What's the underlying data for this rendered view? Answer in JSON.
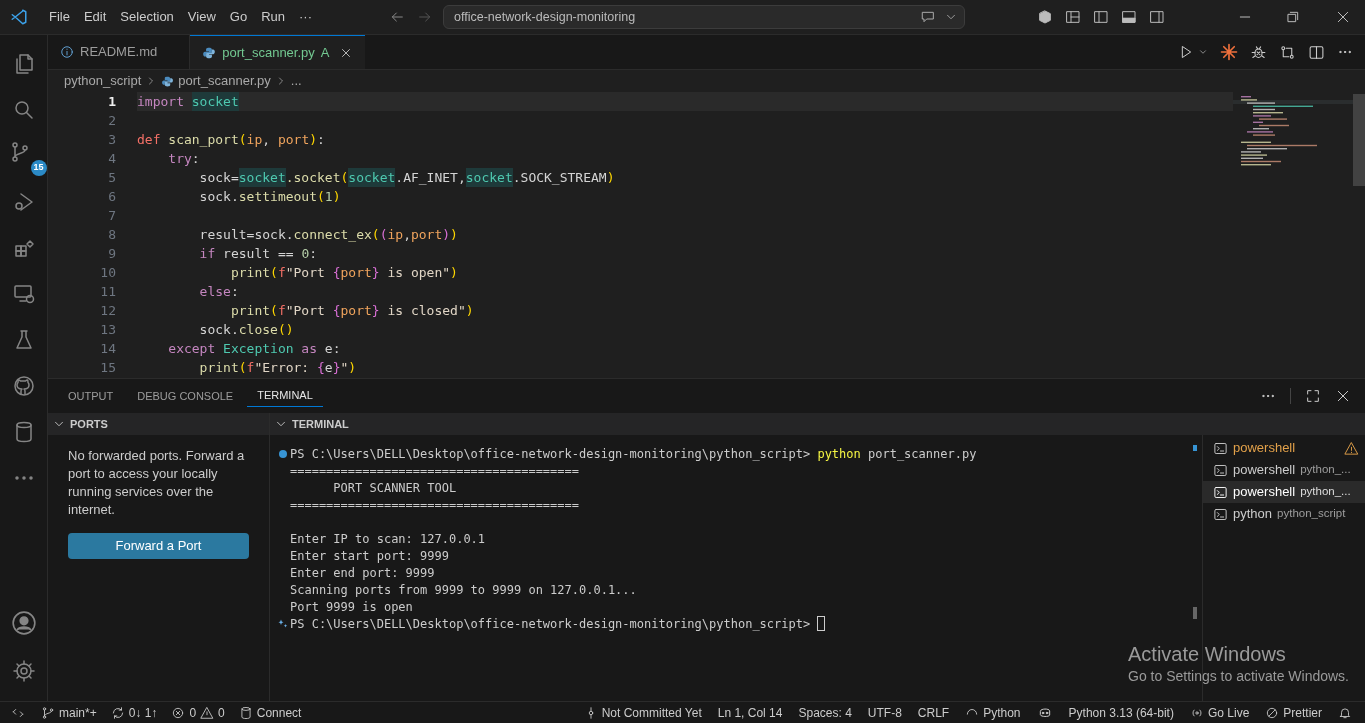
{
  "menu": [
    "File",
    "Edit",
    "Selection",
    "View",
    "Go",
    "Run",
    "···"
  ],
  "command_center": {
    "text": "office-network-design-monitoring"
  },
  "activity_bar": {
    "items": [
      {
        "kind": "files",
        "selected": false
      },
      {
        "kind": "search",
        "selected": false
      },
      {
        "kind": "scm",
        "selected": false,
        "badge": "15"
      },
      {
        "kind": "debug",
        "selected": false
      },
      {
        "kind": "extensions",
        "selected": false
      },
      {
        "kind": "remote",
        "selected": false
      },
      {
        "kind": "testing",
        "selected": false
      },
      {
        "kind": "github",
        "selected": false
      },
      {
        "kind": "database",
        "selected": false
      },
      {
        "kind": "more",
        "selected": false
      }
    ]
  },
  "tabs": [
    {
      "label": "README.md",
      "kind": "info",
      "selected": false
    },
    {
      "label": "port_scanner.py",
      "kind": "python",
      "selected": true,
      "status": "A"
    }
  ],
  "breadcrumbs": [
    "python_script",
    "port_scanner.py",
    "..."
  ],
  "code": [
    {
      "number": "1",
      "current": true,
      "tokens": [
        {
          "text": "import ",
          "kind": "kw"
        },
        {
          "text": "socket",
          "kind": "mod"
        }
      ]
    },
    {
      "number": "2",
      "current": false
    },
    {
      "number": "3",
      "current": false,
      "tokens": [
        {
          "text": "def",
          "kind": "def"
        },
        {
          "text": " scan_port",
          "kind": "fn"
        },
        {
          "text": "(",
          "kind": "p1"
        },
        {
          "text": "ip",
          "kind": "param"
        },
        {
          "text": ", ",
          "kind": "plain"
        },
        {
          "text": "port",
          "kind": "param"
        },
        {
          "text": ")",
          "kind": "p1"
        },
        {
          "text": ":",
          "kind": "plain"
        }
      ]
    },
    {
      "number": "4",
      "current": false,
      "tokens": [
        {
          "text": "    try",
          "kind": "kw"
        },
        {
          "text": ":",
          "kind": "plain"
        }
      ]
    },
    {
      "number": "5",
      "current": false,
      "tokens": [
        {
          "text": "        sock=",
          "kind": "plain"
        },
        {
          "text": "socket",
          "kind": "mod"
        },
        {
          "text": ".socket",
          "kind": "fn"
        },
        {
          "text": "(",
          "kind": "p1"
        },
        {
          "text": "socket",
          "kind": "mod"
        },
        {
          "text": ".AF_INET,",
          "kind": "plain"
        },
        {
          "text": "socket",
          "kind": "mod"
        },
        {
          "text": ".SOCK_STREAM",
          "kind": "plain"
        },
        {
          "text": ")",
          "kind": "p1"
        }
      ]
    },
    {
      "number": "6",
      "current": false,
      "tokens": [
        {
          "text": "        sock.",
          "kind": "plain"
        },
        {
          "text": "settimeout",
          "kind": "fn"
        },
        {
          "text": "(",
          "kind": "p1"
        },
        {
          "text": "1",
          "kind": "num"
        },
        {
          "text": ")",
          "kind": "p1"
        }
      ]
    },
    {
      "number": "7",
      "current": false
    },
    {
      "number": "8",
      "current": false,
      "tokens": [
        {
          "text": "        result=sock.",
          "kind": "plain"
        },
        {
          "text": "connect_ex",
          "kind": "fn"
        },
        {
          "text": "(",
          "kind": "p1"
        },
        {
          "text": "(",
          "kind": "p2"
        },
        {
          "text": "ip",
          "kind": "param"
        },
        {
          "text": ",",
          "kind": "plain"
        },
        {
          "text": "port",
          "kind": "param"
        },
        {
          "text": ")",
          "kind": "p2"
        },
        {
          "text": ")",
          "kind": "p1"
        }
      ]
    },
    {
      "number": "9",
      "current": false,
      "tokens": [
        {
          "text": "        if",
          "kind": "kw"
        },
        {
          "text": " result == ",
          "kind": "plain"
        },
        {
          "text": "0",
          "kind": "num"
        },
        {
          "text": ":",
          "kind": "plain"
        }
      ]
    },
    {
      "number": "10",
      "current": false,
      "tokens": [
        {
          "text": "            print",
          "kind": "fn"
        },
        {
          "text": "(",
          "kind": "p1"
        },
        {
          "text": "f",
          "kind": "def"
        },
        {
          "text": "\"Port ",
          "kind": "str"
        },
        {
          "text": "{",
          "kind": "p2"
        },
        {
          "text": "port",
          "kind": "param"
        },
        {
          "text": "}",
          "kind": "p2"
        },
        {
          "text": " is open\"",
          "kind": "str"
        },
        {
          "text": ")",
          "kind": "p1"
        }
      ]
    },
    {
      "number": "11",
      "current": false,
      "tokens": [
        {
          "text": "        else",
          "kind": "kw"
        },
        {
          "text": ":",
          "kind": "plain"
        }
      ]
    },
    {
      "number": "12",
      "current": false,
      "tokens": [
        {
          "text": "            print",
          "kind": "fn"
        },
        {
          "text": "(",
          "kind": "p1"
        },
        {
          "text": "f",
          "kind": "def"
        },
        {
          "text": "\"Port ",
          "kind": "str"
        },
        {
          "text": "{",
          "kind": "p2"
        },
        {
          "text": "port",
          "kind": "param"
        },
        {
          "text": "}",
          "kind": "p2"
        },
        {
          "text": " is closed\"",
          "kind": "str"
        },
        {
          "text": ")",
          "kind": "p1"
        }
      ]
    },
    {
      "number": "13",
      "current": false,
      "tokens": [
        {
          "text": "        sock.",
          "kind": "plain"
        },
        {
          "text": "close",
          "kind": "fn"
        },
        {
          "text": "()",
          "kind": "p1"
        }
      ]
    },
    {
      "number": "14",
      "current": false,
      "tokens": [
        {
          "text": "    except ",
          "kind": "kw"
        },
        {
          "text": "Exception",
          "kind": "cls"
        },
        {
          "text": " as",
          "kind": "kw"
        },
        {
          "text": " e:",
          "kind": "plain"
        }
      ]
    },
    {
      "number": "15",
      "current": false,
      "tokens": [
        {
          "text": "        print",
          "kind": "fn"
        },
        {
          "text": "(",
          "kind": "p1"
        },
        {
          "text": "f",
          "kind": "def"
        },
        {
          "text": "\"Error: ",
          "kind": "str"
        },
        {
          "text": "{",
          "kind": "p2"
        },
        {
          "text": "e",
          "kind": "plain"
        },
        {
          "text": "}",
          "kind": "p2"
        },
        {
          "text": "\"",
          "kind": "str"
        },
        {
          "text": ")",
          "kind": "p1"
        }
      ]
    }
  ],
  "panel_tabs": [
    {
      "label": "OUTPUT",
      "selected": false
    },
    {
      "label": "DEBUG CONSOLE",
      "selected": false
    },
    {
      "label": "TERMINAL",
      "selected": true
    }
  ],
  "ports": {
    "title": "PORTS",
    "message": "No forwarded ports. Forward a port to access your locally running services over the internet.",
    "button": "Forward a Port"
  },
  "terminal": {
    "title": "TERMINAL",
    "lines": [
      {
        "kind": "prompt",
        "decoration": {
          "kind": "dot"
        },
        "prompt": "PS C:\\Users\\DELL\\Desktop\\office-network-design-monitoring\\python_script> ",
        "command": "python",
        "args": " port_scanner.py",
        "cursor": false
      },
      {
        "kind": "output",
        "text": "========================================"
      },
      {
        "kind": "output",
        "text": "      PORT SCANNER TOOL"
      },
      {
        "kind": "output",
        "text": "========================================"
      },
      {
        "kind": "blank"
      },
      {
        "kind": "output",
        "text": "Enter IP to scan: 127.0.0.1"
      },
      {
        "kind": "output",
        "text": "Enter start port: 9999"
      },
      {
        "kind": "output",
        "text": "Enter end port: 9999"
      },
      {
        "kind": "output",
        "text": "Scanning ports from 9999 to 9999 on 127.0.0.1..."
      },
      {
        "kind": "output",
        "text": "Port 9999 is open"
      },
      {
        "kind": "prompt",
        "decoration": {
          "kind": "sparkle"
        },
        "prompt": "PS C:\\Users\\DELL\\Desktop\\office-network-design-monitoring\\python_script> ",
        "cursor": true
      }
    ],
    "sessions": [
      {
        "name": "powershell",
        "warning": true,
        "selected": false
      },
      {
        "name": "powershell",
        "detail": "python_...",
        "warning": false,
        "selected": false
      },
      {
        "name": "powershell",
        "detail": "python_...",
        "warning": false,
        "selected": true
      },
      {
        "name": "python",
        "detail": "python_script",
        "warning": false,
        "selected": false
      }
    ]
  },
  "status_bar": {
    "left": [
      {
        "kind": "branch",
        "text": "main*+"
      },
      {
        "kind": "sync",
        "text": "0↓ 1↑"
      },
      {
        "kind": "problems",
        "errors": "0",
        "warnings": "0"
      },
      {
        "kind": "db",
        "text": "Connect"
      }
    ],
    "right": [
      {
        "kind": "commit",
        "text": "Not Committed Yet"
      },
      {
        "kind": "plain",
        "text": "Ln 1, Col 14"
      },
      {
        "kind": "plain",
        "text": "Spaces: 4"
      },
      {
        "kind": "plain",
        "text": "UTF-8"
      },
      {
        "kind": "plain",
        "text": "CRLF"
      },
      {
        "kind": "lang",
        "text": "Python"
      },
      {
        "kind": "copilot"
      },
      {
        "kind": "plain",
        "text": "Python 3.13 (64-bit)"
      },
      {
        "kind": "live",
        "text": "Go Live"
      },
      {
        "kind": "prettier",
        "text": "Prettier"
      },
      {
        "kind": "bell"
      }
    ]
  },
  "activation_notice": {
    "title": "Activate Windows",
    "text": "Go to Settings to activate Windows."
  }
}
